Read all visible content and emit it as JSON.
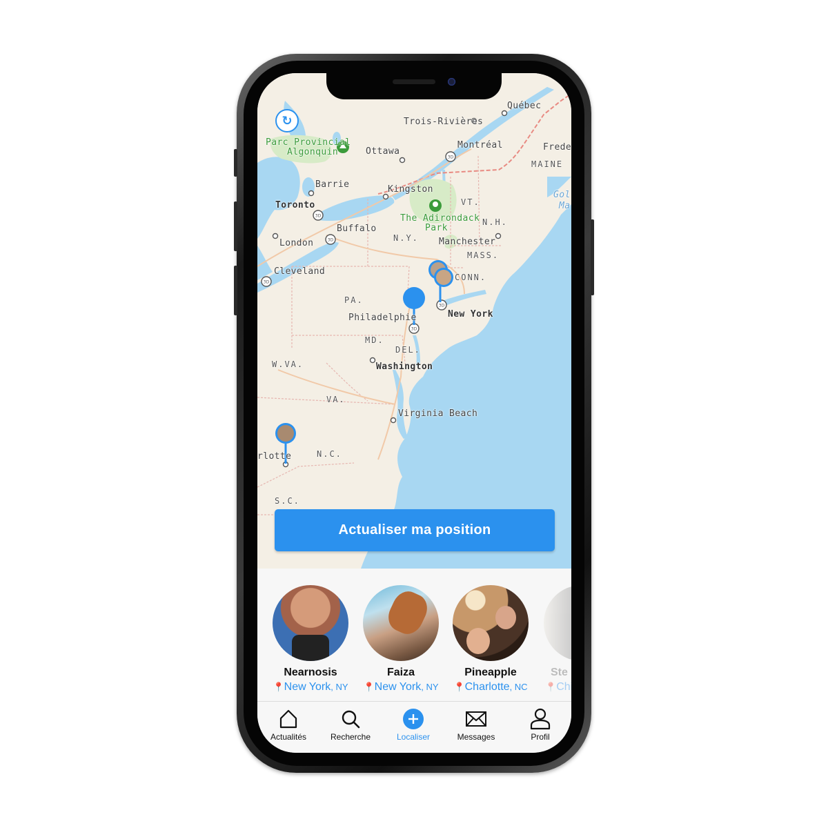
{
  "map": {
    "labels": {
      "quebec": "Québec",
      "trois_rivieres": "Trois-Rivières",
      "parc": "Parc Provincial",
      "algonquin": "Algonquin",
      "ottawa": "Ottawa",
      "montreal": "Montréal",
      "frede": "Frede",
      "maine": "MAINE",
      "barrie": "Barrie",
      "kingston": "Kingston",
      "toronto": "Toronto",
      "vt": "VT.",
      "adirondack": "The Adirondack",
      "adirondack_park": "Park",
      "gol": "Gol",
      "ma_partial": "Ma",
      "buffalo": "Buffalo",
      "nh": "N.H.",
      "ny": "N.Y.",
      "london": "London",
      "manchester": "Manchester",
      "mass": "MASS.",
      "cleveland": "Cleveland",
      "conn": "CONN.",
      "pa": "PA.",
      "philadelphia": "Philadelphie",
      "new_york": "New York",
      "md": "MD.",
      "del": "DEL.",
      "wva": "W.VA.",
      "washington": "Washington",
      "va": "VA.",
      "virginia_beach": "Virginia Beach",
      "charlotte_partial": "rlotte",
      "nc": "N.C.",
      "sc": "S.C."
    },
    "refresh_icon": "refresh-icon",
    "update_button_label": "Actualiser ma position"
  },
  "people": [
    {
      "name": "Nearnosis",
      "city": "New York",
      "state": "NY"
    },
    {
      "name": "Faiza",
      "city": "New York",
      "state": "NY"
    },
    {
      "name": "Pineapple",
      "city": "Charlotte",
      "state": "NC"
    },
    {
      "name": "Ste",
      "city": "Chi",
      "state": ""
    }
  ],
  "tabs": [
    {
      "label": "Actualités",
      "icon": "home-icon"
    },
    {
      "label": "Recherche",
      "icon": "search-icon"
    },
    {
      "label": "Localiser",
      "icon": "add-circle-icon"
    },
    {
      "label": "Messages",
      "icon": "envelope-icon"
    },
    {
      "label": "Profil",
      "icon": "user-icon"
    }
  ],
  "colors": {
    "accent": "#2b91ee",
    "water": "#a8d7f2",
    "land": "#f4efe5",
    "park": "#3b9b3b",
    "pin": "#e0392b"
  }
}
